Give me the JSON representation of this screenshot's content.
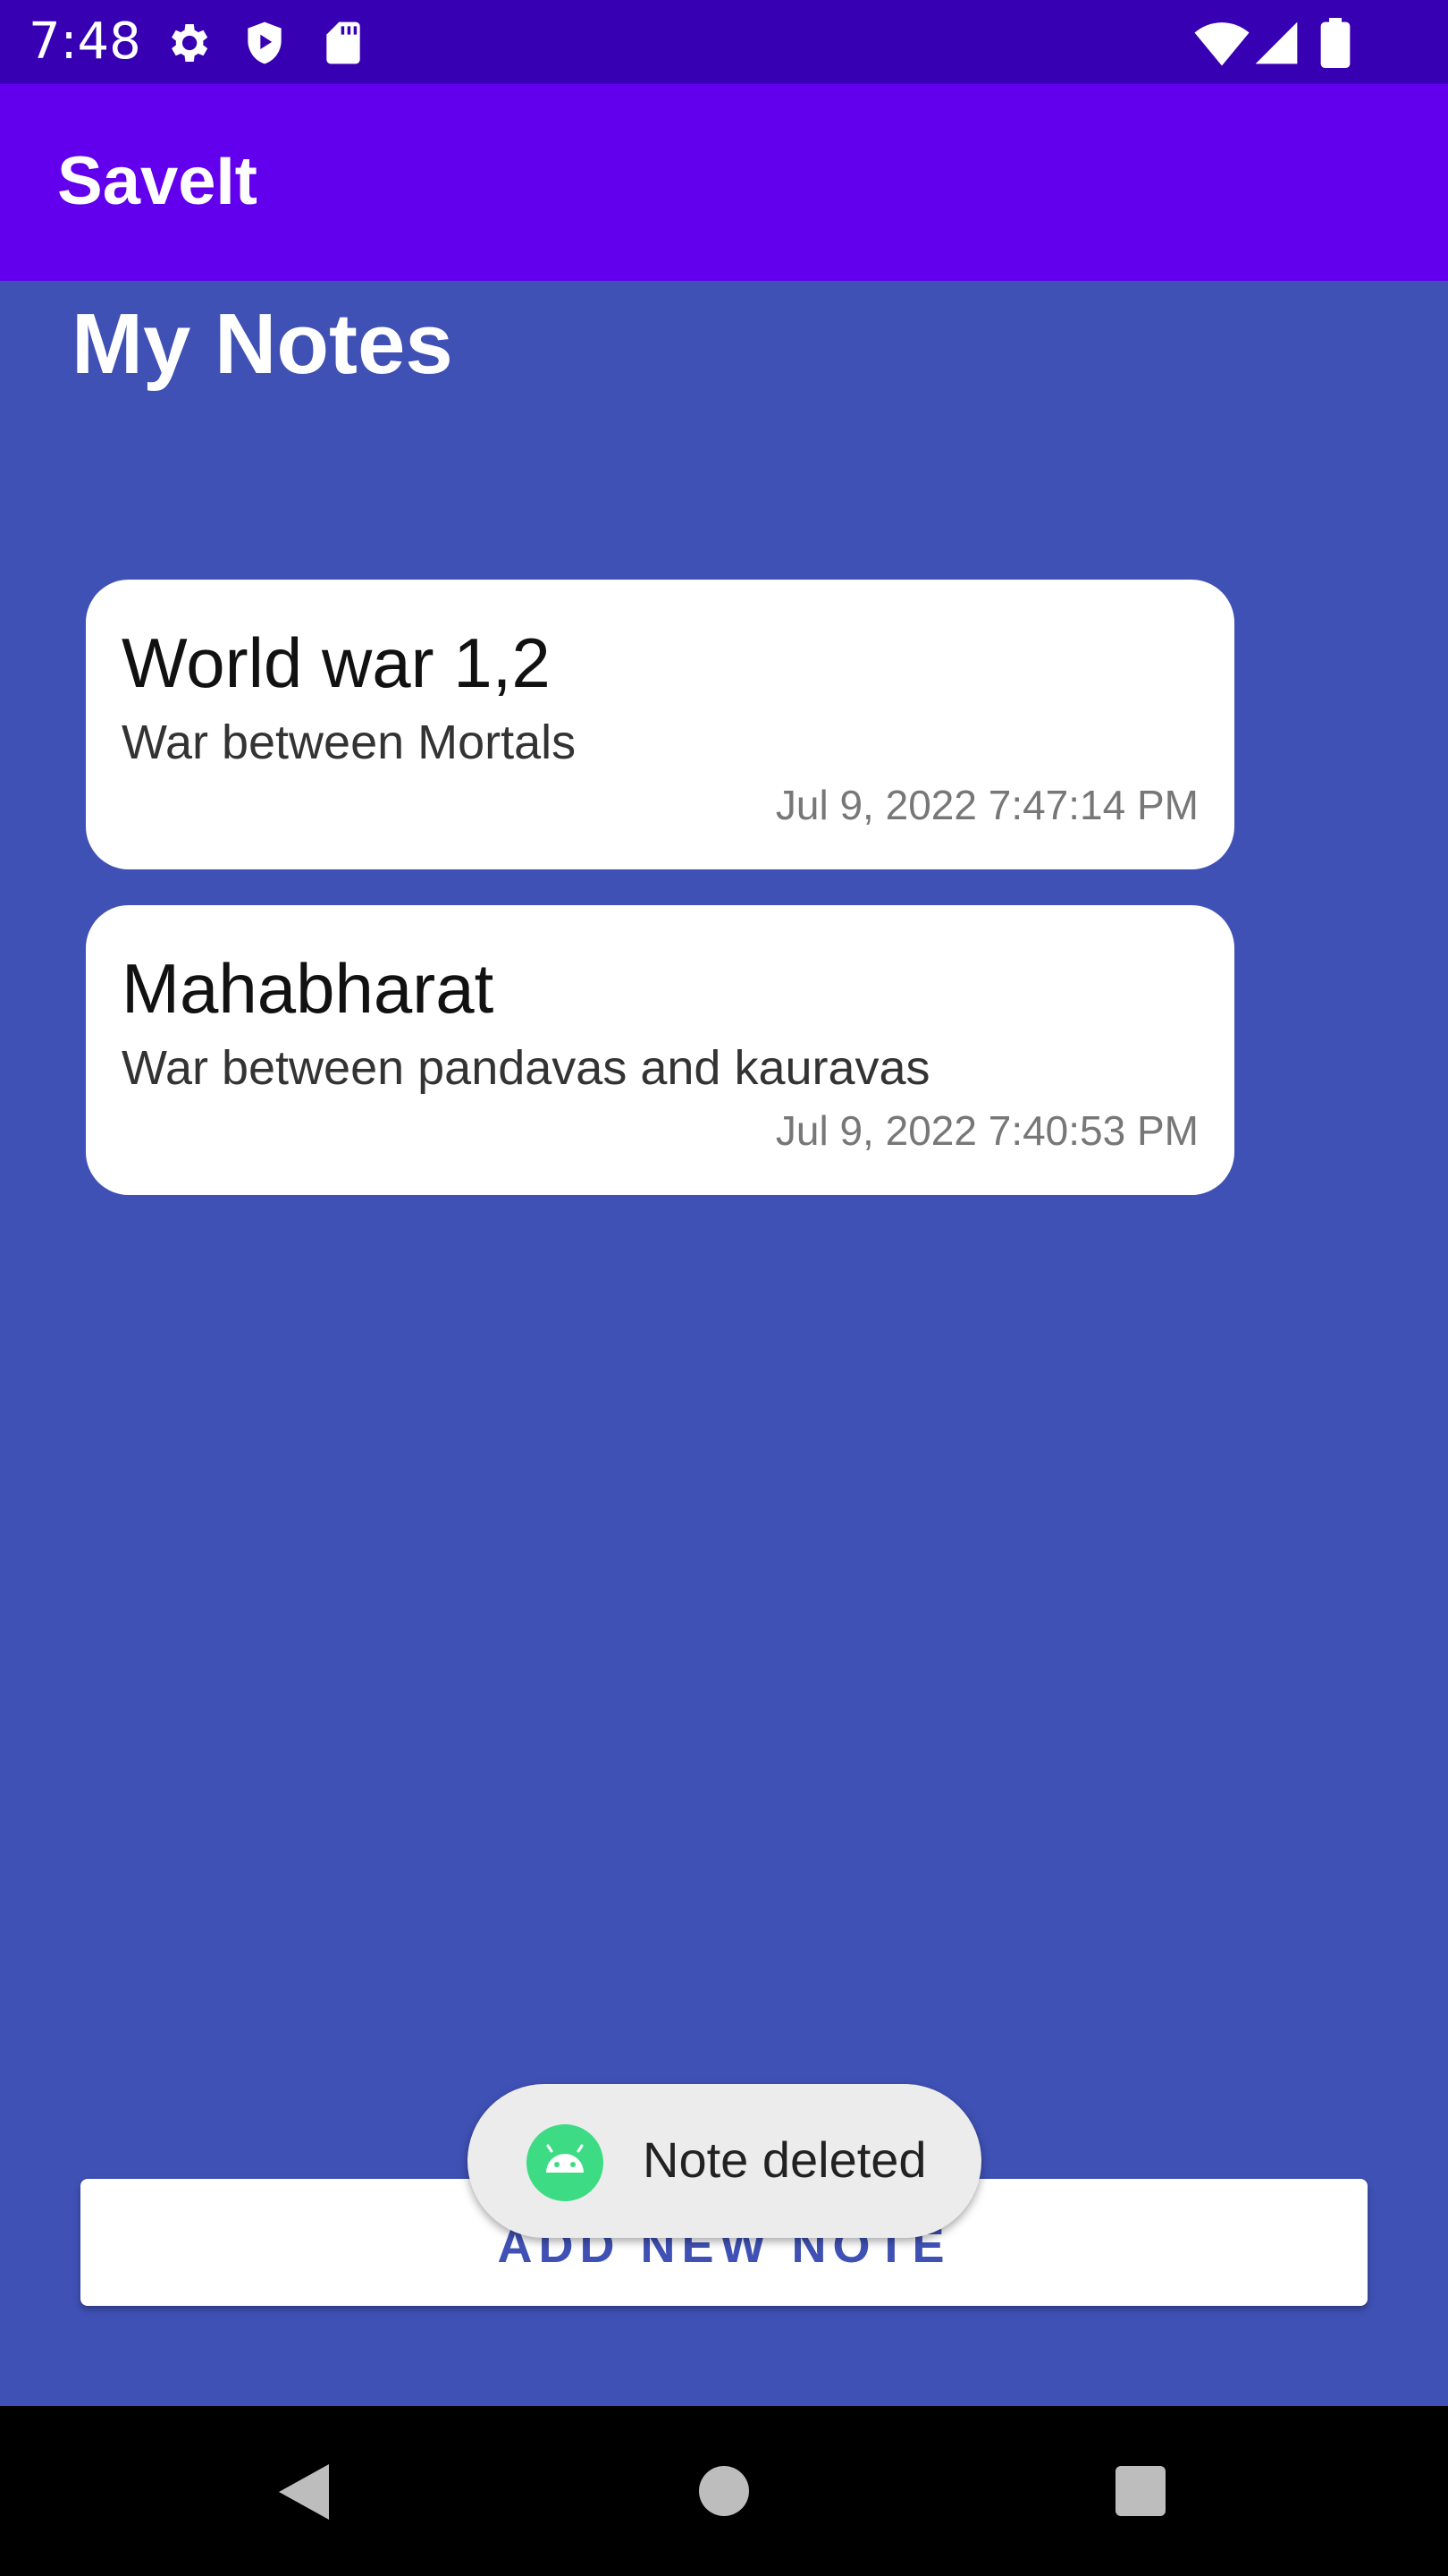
{
  "status_bar": {
    "time": "7:48",
    "left_icons": [
      "gear-icon",
      "shield-play-icon",
      "sd-card-icon"
    ],
    "right_icons": [
      "wifi-icon",
      "signal-icon",
      "battery-icon"
    ]
  },
  "app_bar": {
    "title": "SaveIt"
  },
  "page": {
    "title": "My Notes"
  },
  "notes": [
    {
      "title": "World war 1,2",
      "description": "War between Mortals",
      "timestamp": "Jul 9, 2022 7:47:14 PM"
    },
    {
      "title": "Mahabharat",
      "description": "War between pandavas and kauravas",
      "timestamp": "Jul 9, 2022 7:40:53 PM"
    }
  ],
  "add_button": {
    "label": "ADD NEW NOTE"
  },
  "toast": {
    "message": "Note deleted",
    "icon": "android-icon"
  },
  "nav_bar": {
    "buttons": [
      "back-icon",
      "home-icon",
      "recents-icon"
    ]
  },
  "colors": {
    "status_bar": "#3700B3",
    "app_bar": "#6200EE",
    "background": "#3F51B5",
    "card": "#FFFFFF",
    "toast_bg": "#ECECEC",
    "android_green": "#3DDC84"
  }
}
